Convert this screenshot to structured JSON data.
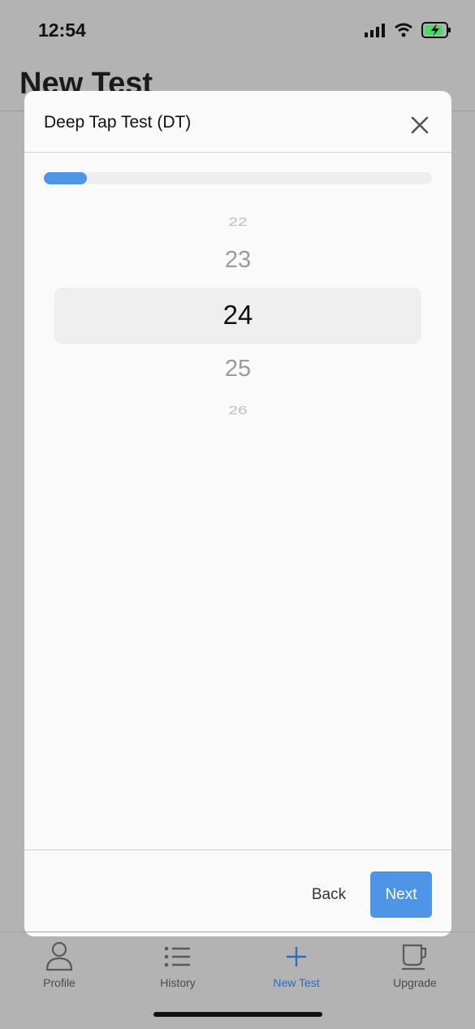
{
  "status": {
    "time": "12:54"
  },
  "background": {
    "title": "New Test"
  },
  "modal": {
    "title": "Deep Tap Test (DT)",
    "progress": 0.11,
    "picker": {
      "values": [
        "22",
        "23",
        "24",
        "25",
        "26"
      ],
      "selected": "24"
    },
    "footer": {
      "back_label": "Back",
      "next_label": "Next"
    }
  },
  "tabs": [
    {
      "label": "Profile",
      "icon": "person-icon"
    },
    {
      "label": "History",
      "icon": "list-icon"
    },
    {
      "label": "New Test",
      "icon": "plus-icon",
      "active": true
    },
    {
      "label": "Upgrade",
      "icon": "cup-icon"
    }
  ],
  "colors": {
    "accent": "#4f95e6",
    "active_tab": "#2c6cb8",
    "overlay": "#b3b3b3"
  }
}
